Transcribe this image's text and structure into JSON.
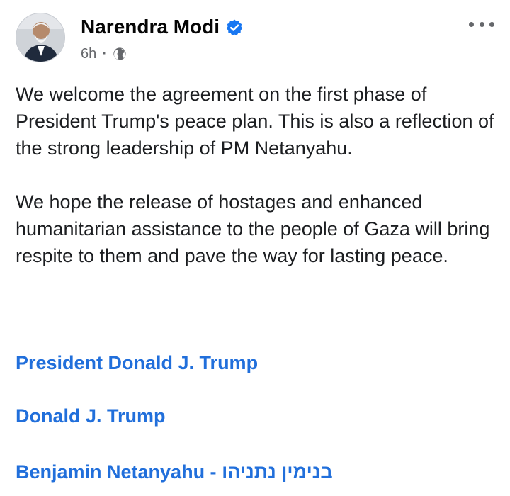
{
  "post": {
    "author": "Narendra Modi",
    "time": "6h",
    "separator": "·",
    "icons": {
      "verified": "verified-badge-icon",
      "audience": "globe-icon",
      "more": "more-options-icon",
      "avatar": "profile-photo"
    },
    "paragraphs": [
      "We welcome the agreement on the first phase of President Trump's peace plan. This is also a reflection of the strong leadership of PM Netanyahu.",
      "We hope the release of hostages and enhanced humanitarian assistance to the people of Gaza will bring respite to them and pave the way for lasting peace."
    ],
    "mentions": [
      "President Donald J. Trump",
      "Donald J. Trump",
      "Benjamin Netanyahu - בנימין נתניהו"
    ]
  },
  "colors": {
    "link": "#216fdb",
    "text": "#1c1e21",
    "meta": "#65676b",
    "verified": "#1877f2"
  }
}
